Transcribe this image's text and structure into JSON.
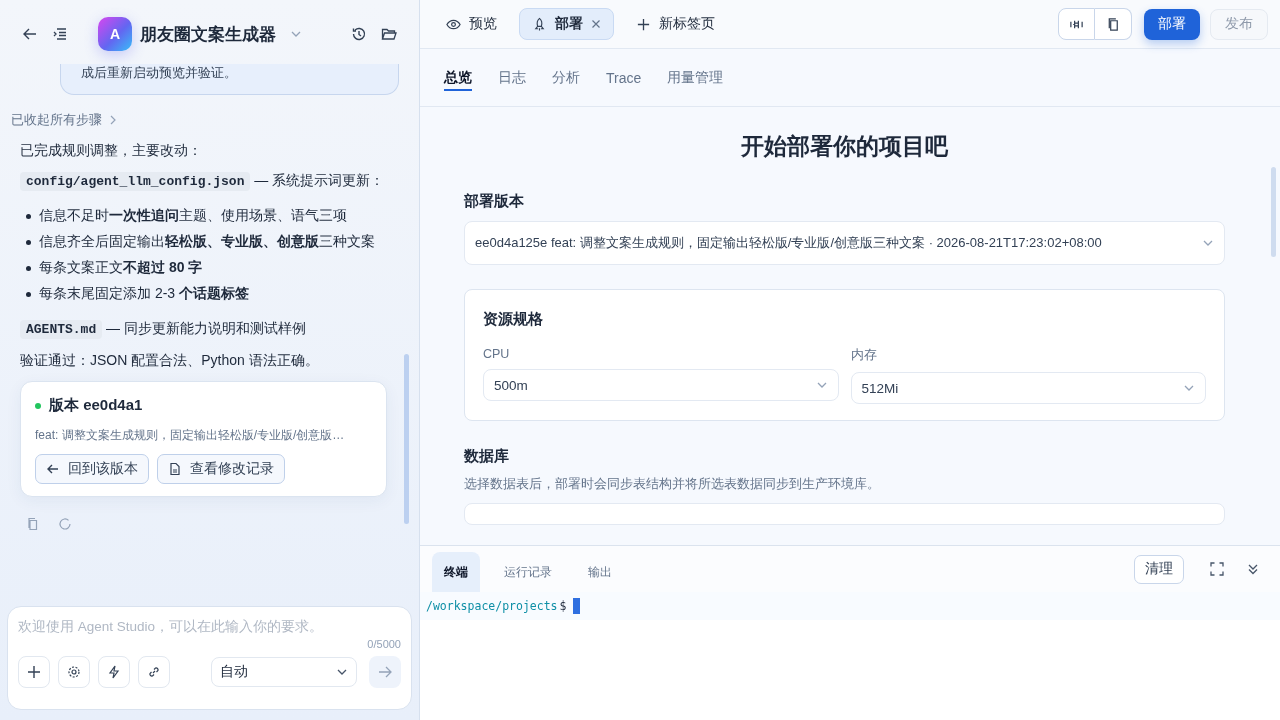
{
  "sidebar": {
    "app_icon_letter": "A",
    "app_name": "朋友圈文案生成器",
    "chat": {
      "bubble_text": "成后重新启动预览并验证。",
      "collapsed_steps": "已收起所有步骤",
      "summary": "已完成规则调整，主要改动：",
      "files": [
        {
          "path": "config/agent_llm_config.json",
          "note": "— 系统提示词更新：",
          "bullets": [
            "信息不足时**一次性追问**主题、使用场景、语气三项",
            "信息齐全后固定输出**轻松版、专业版、创意版**三种文案",
            "每条文案正文**不超过 80 字**",
            "每条末尾固定添加 2-3 **个话题标签**"
          ]
        },
        {
          "path": "AGENTS.md",
          "note": "— 同步更新能力说明和测试样例"
        }
      ],
      "verification": "验证通过：JSON 配置合法、Python 语法正确。",
      "version_card": {
        "title": "版本 ee0d4a1",
        "color": "#22c55e",
        "message": "feat: 调整文案生成规则，固定输出轻松版/专业版/创意版…",
        "buttons": [
          {
            "label": "回到该版本",
            "kind": "back"
          },
          {
            "label": "查看修改记录",
            "kind": "file"
          }
        ]
      }
    },
    "composer": {
      "placeholder": "欢迎使用 Agent Studio，可以在此输入你的要求。",
      "counter": "0/5000",
      "mode": "自动"
    }
  },
  "tabs": [
    {
      "label": "预览",
      "kind": "eye",
      "selected": false,
      "closable": false
    },
    {
      "label": "部署",
      "kind": "rocket",
      "selected": true,
      "closable": true
    },
    {
      "label": "新标签页",
      "kind": "plus",
      "selected": false,
      "closable": false
    }
  ],
  "toolbar": {
    "deploy_button": "部署",
    "publish_button": {
      "label": "发布",
      "disabled": true
    }
  },
  "subtabs": [
    {
      "label": "总览",
      "selected": true
    },
    {
      "label": "日志",
      "selected": false
    },
    {
      "label": "分析",
      "selected": false
    },
    {
      "label": "Trace",
      "selected": false
    },
    {
      "label": "用量管理",
      "selected": false
    }
  ],
  "deploy": {
    "heading": "开始部署你的项目吧",
    "version_label": "部署版本",
    "version_value": "ee0d4a125e feat: 调整文案生成规则，固定输出轻松版/专业版/创意版三种文案 · 2026-08-21T17:23:02+08:00",
    "resources": {
      "title": "资源规格",
      "fields": [
        {
          "label": "CPU",
          "value": "500m"
        },
        {
          "label": "内存",
          "value": "512Mi"
        }
      ]
    },
    "database": {
      "title": "数据库",
      "description": "选择数据表后，部署时会同步表结构并将所选表数据同步到生产环境库。"
    }
  },
  "terminal": {
    "tabs": [
      {
        "label": "终端",
        "selected": true
      },
      {
        "label": "运行记录",
        "selected": false
      },
      {
        "label": "输出",
        "selected": false
      }
    ],
    "clear_button": "清理",
    "path": "/workspace/projects",
    "prompt": "$"
  }
}
